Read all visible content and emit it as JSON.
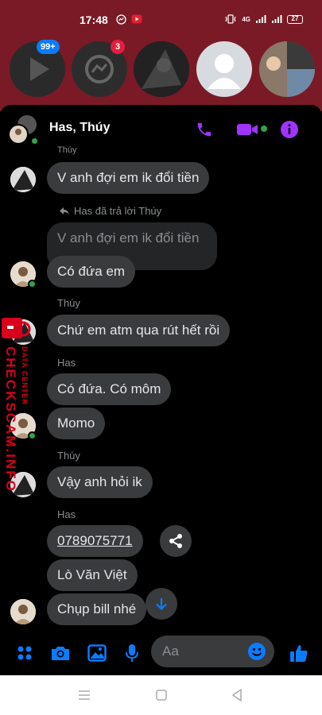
{
  "status": {
    "time": "17:48",
    "net_label": "4G",
    "battery": "27"
  },
  "chat_heads": {
    "messenger_badge_1": "99+",
    "messenger_badge_2": "3"
  },
  "header": {
    "title": "Has, Thúy"
  },
  "messages": {
    "sender_top": "Thúy",
    "m1": "V anh đợi em ik đổi tiền",
    "reply_note": "Has đã trả lời Thúy",
    "quoted": "V anh đợi em ik đổi tiền",
    "m2": "Có đứa em",
    "sender_thuy_1": "Thúy",
    "m3": "Chứ em atm qua rút hết rồi",
    "sender_has_1": "Has",
    "m4": "Có đứa. Có môm",
    "m5": "Momo",
    "sender_thuy_2": "Thúy",
    "m6": "Vậy anh hỏi ik",
    "sender_has_2": "Has",
    "m7": "0789075771",
    "m8": "Lò Văn Việt",
    "m9": "Chụp bill nhé"
  },
  "composer": {
    "placeholder": "Aa"
  },
  "watermark": {
    "brand": "CHECKSCAM.INFO",
    "sub": "DATA CENTER"
  },
  "colors": {
    "accent_purple": "#a033ff",
    "accent_blue": "#0a7cff",
    "bubble_gray": "#3a3b3c",
    "online_green": "#31a24c",
    "watermark_red": "#d9001b"
  }
}
